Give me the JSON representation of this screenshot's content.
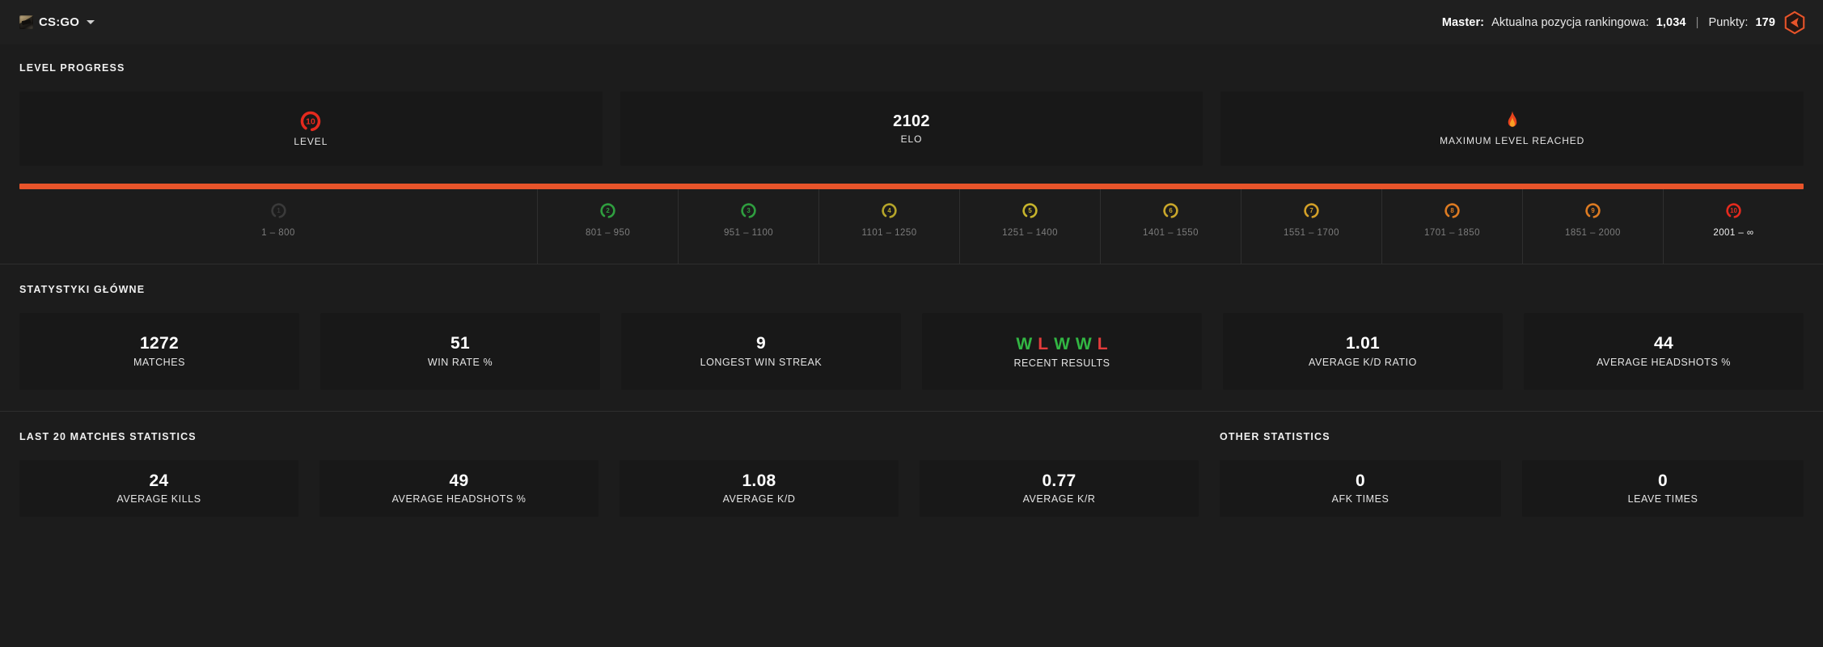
{
  "topbar": {
    "game_label": "CS:GO",
    "game_icon": "csgo-thumbnail",
    "caret_icon": "chevron-down-icon",
    "rank_title": "Master:",
    "rank_text": "Aktualna pozycja rankingowa:",
    "rank_value": "1,034",
    "separator": "|",
    "points_text": "Punkty:",
    "points_value": "179",
    "rank_badge_icon": "faceit-rank-hex-icon"
  },
  "level_progress": {
    "title": "LEVEL PROGRESS",
    "cards": [
      {
        "icon": "level-10-badge-icon",
        "value": "",
        "label": "LEVEL"
      },
      {
        "icon": "",
        "value": "2102",
        "label": "ELO"
      },
      {
        "icon": "flame-icon",
        "value": "",
        "label": "MAXIMUM LEVEL REACHED"
      }
    ],
    "progress_percent": 100,
    "bar_color": "#e8542a",
    "ticks": [
      {
        "level": "1",
        "range": "1 – 800",
        "color": "#3a3a3a",
        "active": false,
        "flex": 3.7
      },
      {
        "level": "2",
        "range": "801 – 950",
        "color": "#2f9e3f",
        "active": false,
        "flex": 1
      },
      {
        "level": "3",
        "range": "951 – 1100",
        "color": "#2f9e3f",
        "active": false,
        "flex": 1
      },
      {
        "level": "4",
        "range": "1101 – 1250",
        "color": "#b5a52a",
        "active": false,
        "flex": 1
      },
      {
        "level": "5",
        "range": "1251 – 1400",
        "color": "#c6b42c",
        "active": false,
        "flex": 1
      },
      {
        "level": "6",
        "range": "1401 – 1550",
        "color": "#c9a72b",
        "active": false,
        "flex": 1
      },
      {
        "level": "7",
        "range": "1551 – 1700",
        "color": "#d3a028",
        "active": false,
        "flex": 1
      },
      {
        "level": "8",
        "range": "1701 – 1850",
        "color": "#dd7b22",
        "active": false,
        "flex": 1
      },
      {
        "level": "9",
        "range": "1851 – 2000",
        "color": "#dd7b22",
        "active": false,
        "flex": 1
      },
      {
        "level": "10",
        "range": "2001 – ∞",
        "color": "#e52a1e",
        "active": true,
        "flex": 1
      }
    ]
  },
  "main_stats": {
    "title": "STATYSTYKI GŁÓWNE",
    "cards": [
      {
        "value": "1272",
        "label": "MATCHES"
      },
      {
        "value": "51",
        "label": "WIN RATE %"
      },
      {
        "value": "9",
        "label": "LONGEST WIN STREAK"
      },
      {
        "value": "",
        "label": "RECENT RESULTS",
        "recent_results": [
          "W",
          "L",
          "W",
          "W",
          "L"
        ]
      },
      {
        "value": "1.01",
        "label": "AVERAGE K/D RATIO"
      },
      {
        "value": "44",
        "label": "AVERAGE HEADSHOTS %"
      }
    ],
    "win_color": "#32b643",
    "loss_color": "#e33b3b"
  },
  "last20": {
    "title": "LAST 20 MATCHES STATISTICS",
    "cards": [
      {
        "value": "24",
        "label": "AVERAGE KILLS"
      },
      {
        "value": "49",
        "label": "AVERAGE HEADSHOTS %"
      },
      {
        "value": "1.08",
        "label": "AVERAGE K/D"
      },
      {
        "value": "0.77",
        "label": "AVERAGE K/R"
      }
    ]
  },
  "other_stats": {
    "title": "OTHER STATISTICS",
    "cards": [
      {
        "value": "0",
        "label": "AFK TIMES"
      },
      {
        "value": "0",
        "label": "LEAVE TIMES"
      }
    ]
  }
}
